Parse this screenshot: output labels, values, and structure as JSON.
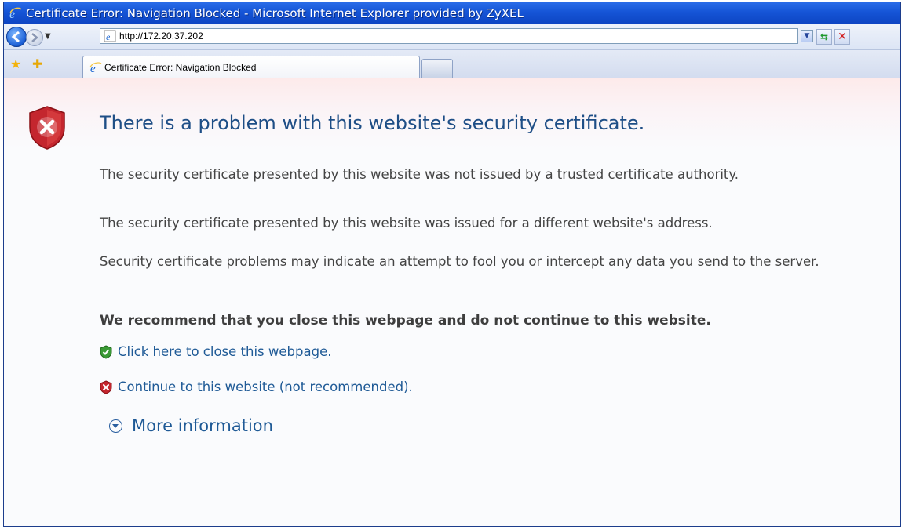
{
  "window": {
    "title": "Certificate Error: Navigation Blocked - Microsoft Internet Explorer provided by ZyXEL"
  },
  "navbar": {
    "address": "http://172.20.37.202",
    "icons": [
      "back-icon",
      "forward-icon",
      "chevron-down-icon",
      "ie-page-icon",
      "refresh-icon",
      "stop-icon"
    ]
  },
  "tabs": {
    "active_label": "Certificate Error: Navigation Blocked",
    "icons": [
      "favorites-star-icon",
      "add-favorite-icon",
      "ie-icon",
      "new-tab-icon"
    ]
  },
  "content": {
    "title": "There is a problem with this website's security certificate.",
    "para1_line1": "The security certificate presented by this website was not issued by a trusted certificate authority.",
    "para1_line2": "The security certificate presented by this website was issued for a different website's address.",
    "para2": "Security certificate problems may indicate an attempt to fool you or intercept any data you send to the server.",
    "recommendation": "We recommend that you close this webpage and do not continue to this website.",
    "close_link": "Click here to close this webpage.",
    "continue_link": "Continue to this website (not recommended).",
    "more_info": "More information"
  },
  "colors": {
    "title_blue": "#1e4e86",
    "link_blue": "#1f5a96",
    "shield_red": "#c4262e",
    "shield_green": "#3a9a35",
    "titlebar_blue": "#1554d6"
  }
}
